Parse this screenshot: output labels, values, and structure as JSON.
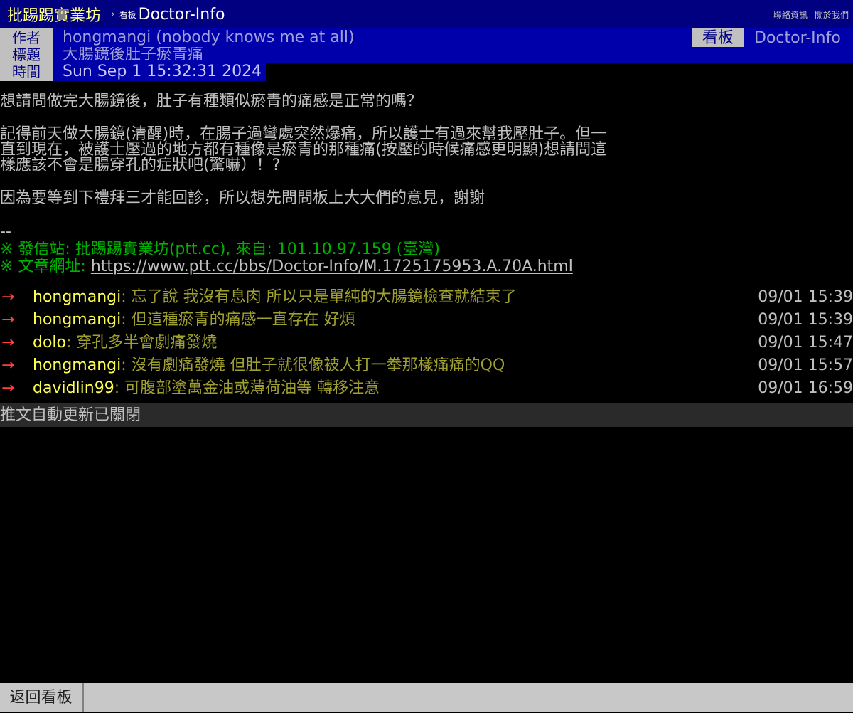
{
  "nav": {
    "site_name": "批踢踢實業坊",
    "separator": "›",
    "board_kind": "看板",
    "board_name": "Doctor-Info",
    "links": [
      "聯絡資訊",
      "關於我們"
    ]
  },
  "meta": {
    "author_label": "作者",
    "author": "hongmangi (nobody knows me at all)",
    "board_label": "看板",
    "board": "Doctor-Info",
    "title_label": "標題",
    "title": "大腸鏡後肚子瘀青痛",
    "time_label": "時間",
    "time": "Sun Sep  1 15:32:31 2024"
  },
  "body": {
    "lines_1": [
      "想請問做完大腸鏡後，肚子有種類似瘀青的痛感是正常的嗎？"
    ],
    "lines_2": [
      "記得前天做大腸鏡(清醒)時，在腸子過彎處突然爆痛，所以護士有過來幫我壓肚子。但一",
      "直到現在，被護士壓過的地方都有種像是瘀青的那種痛(按壓的時候痛感更明顯)想請問這",
      "樣應該不會是腸穿孔的症狀吧(驚嚇）！?"
    ],
    "lines_3": [
      "因為要等到下禮拜三才能回診，所以想先問問板上大大們的意見，謝謝"
    ],
    "signature_sep": "--",
    "source_line": "※ 發信站: 批踢踢實業坊(ptt.cc), 來自: 101.10.97.159 (臺灣)",
    "url_prefix": "※ 文章網址: ",
    "url": "https://www.ptt.cc/bbs/Doctor-Info/M.1725175953.A.70A.html"
  },
  "pushes": [
    {
      "tag": "→",
      "user": "hongmangi",
      "content": ": 忘了說 我沒有息肉 所以只是單純的大腸鏡檢查就結束了",
      "time": "09/01 15:39"
    },
    {
      "tag": "→",
      "user": "hongmangi",
      "content": ":  但這種瘀青的痛感一直存在 好煩",
      "time": "09/01 15:39"
    },
    {
      "tag": "→",
      "user": "dolo",
      "content": ": 穿孔多半會劇痛發燒",
      "time": "09/01 15:47"
    },
    {
      "tag": "→",
      "user": "hongmangi",
      "content": ": 沒有劇痛發燒 但肚子就很像被人打一拳那樣痛痛的QQ",
      "time": "09/01 15:57"
    },
    {
      "tag": "→",
      "user": "davidlin99",
      "content": ": 可腹部塗萬金油或薄荷油等 轉移注意",
      "time": "09/01 16:59"
    }
  ],
  "auto_refresh": "推文自動更新已關閉",
  "footer": {
    "back_label": "返回看板"
  }
}
